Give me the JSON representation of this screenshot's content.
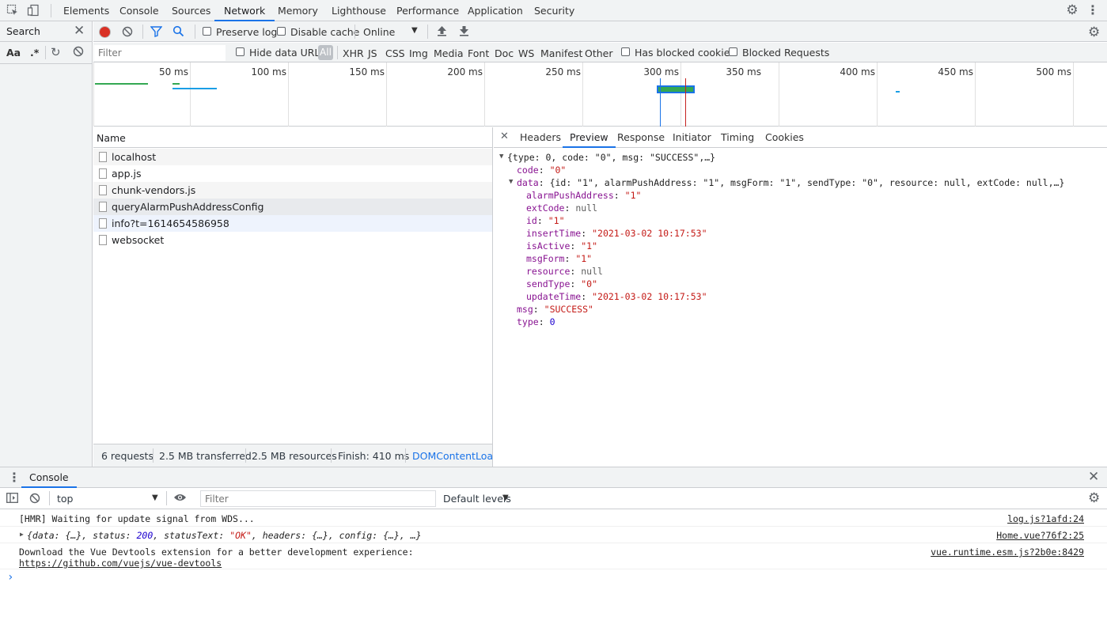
{
  "devtools": {
    "tabs": [
      "Elements",
      "Console",
      "Sources",
      "Network",
      "Memory",
      "Lighthouse",
      "Performance",
      "Application",
      "Security"
    ],
    "active_tab": "Network"
  },
  "search_panel": {
    "title": "Search",
    "case_label": "Aa",
    "regex_label": ".*"
  },
  "network_toolbar": {
    "preserve_log": "Preserve log",
    "disable_cache": "Disable cache",
    "throttle": "Online"
  },
  "filter_bar": {
    "placeholder": "Filter",
    "hide_data_urls": "Hide data URLs",
    "types": [
      "All",
      "XHR",
      "JS",
      "CSS",
      "Img",
      "Media",
      "Font",
      "Doc",
      "WS",
      "Manifest",
      "Other"
    ],
    "has_blocked_cookies": "Has blocked cookies",
    "blocked_requests": "Blocked Requests"
  },
  "overview": {
    "ticks": [
      "50 ms",
      "100 ms",
      "150 ms",
      "200 ms",
      "250 ms",
      "300 ms",
      "350 ms",
      "400 ms",
      "450 ms",
      "500 ms"
    ]
  },
  "requests": {
    "column": "Name",
    "items": [
      "localhost",
      "app.js",
      "chunk-vendors.js",
      "queryAlarmPushAddressConfig",
      "info?t=1614654586958",
      "websocket"
    ]
  },
  "status_bar": {
    "requests": "6 requests",
    "transferred": "2.5 MB transferred",
    "resources": "2.5 MB resources",
    "finish": "Finish: 410 ms",
    "dom": "DOMContentLoade"
  },
  "detail_tabs": {
    "items": [
      "Headers",
      "Preview",
      "Response",
      "Initiator",
      "Timing",
      "Cookies"
    ],
    "active": "Preview"
  },
  "preview": {
    "root": "{type: 0, code: \"0\", msg: \"SUCCESS\",…}",
    "code_key": "code",
    "code_val": "\"0\"",
    "data_key": "data",
    "data_summary": "{id: \"1\", alarmPushAddress: \"1\", msgForm: \"1\", sendType: \"0\", resource: null, extCode: null,…}",
    "fields": [
      {
        "k": "alarmPushAddress",
        "v": "\"1\"",
        "t": "s"
      },
      {
        "k": "extCode",
        "v": "null",
        "t": "nul"
      },
      {
        "k": "id",
        "v": "\"1\"",
        "t": "s"
      },
      {
        "k": "insertTime",
        "v": "\"2021-03-02 10:17:53\"",
        "t": "s"
      },
      {
        "k": "isActive",
        "v": "\"1\"",
        "t": "s"
      },
      {
        "k": "msgForm",
        "v": "\"1\"",
        "t": "s"
      },
      {
        "k": "resource",
        "v": "null",
        "t": "nul"
      },
      {
        "k": "sendType",
        "v": "\"0\"",
        "t": "s"
      },
      {
        "k": "updateTime",
        "v": "\"2021-03-02 10:17:53\"",
        "t": "s"
      }
    ],
    "msg_key": "msg",
    "msg_val": "\"SUCCESS\"",
    "type_key": "type",
    "type_val": "0"
  },
  "console": {
    "title": "Console",
    "context": "top",
    "filter_placeholder": "Filter",
    "levels": "Default levels",
    "messages": [
      {
        "text": "[HMR] Waiting for update signal from WDS...",
        "source": "log.js?1afd:24"
      },
      {
        "text": "Home.vue?76f2:25"
      },
      {
        "text": "Download the Vue Devtools extension for a better development experience:",
        "link": "https://github.com/vuejs/vue-devtools",
        "source": "vue.runtime.esm.js?2b0e:8429"
      }
    ],
    "obj_prefix": "{data: {…}, status: ",
    "obj_status": "200",
    "obj_mid": ", statusText: ",
    "obj_statustext": "\"OK\"",
    "obj_suffix": ", headers: {…}, config: {…}, …}",
    "prompt": "›"
  }
}
